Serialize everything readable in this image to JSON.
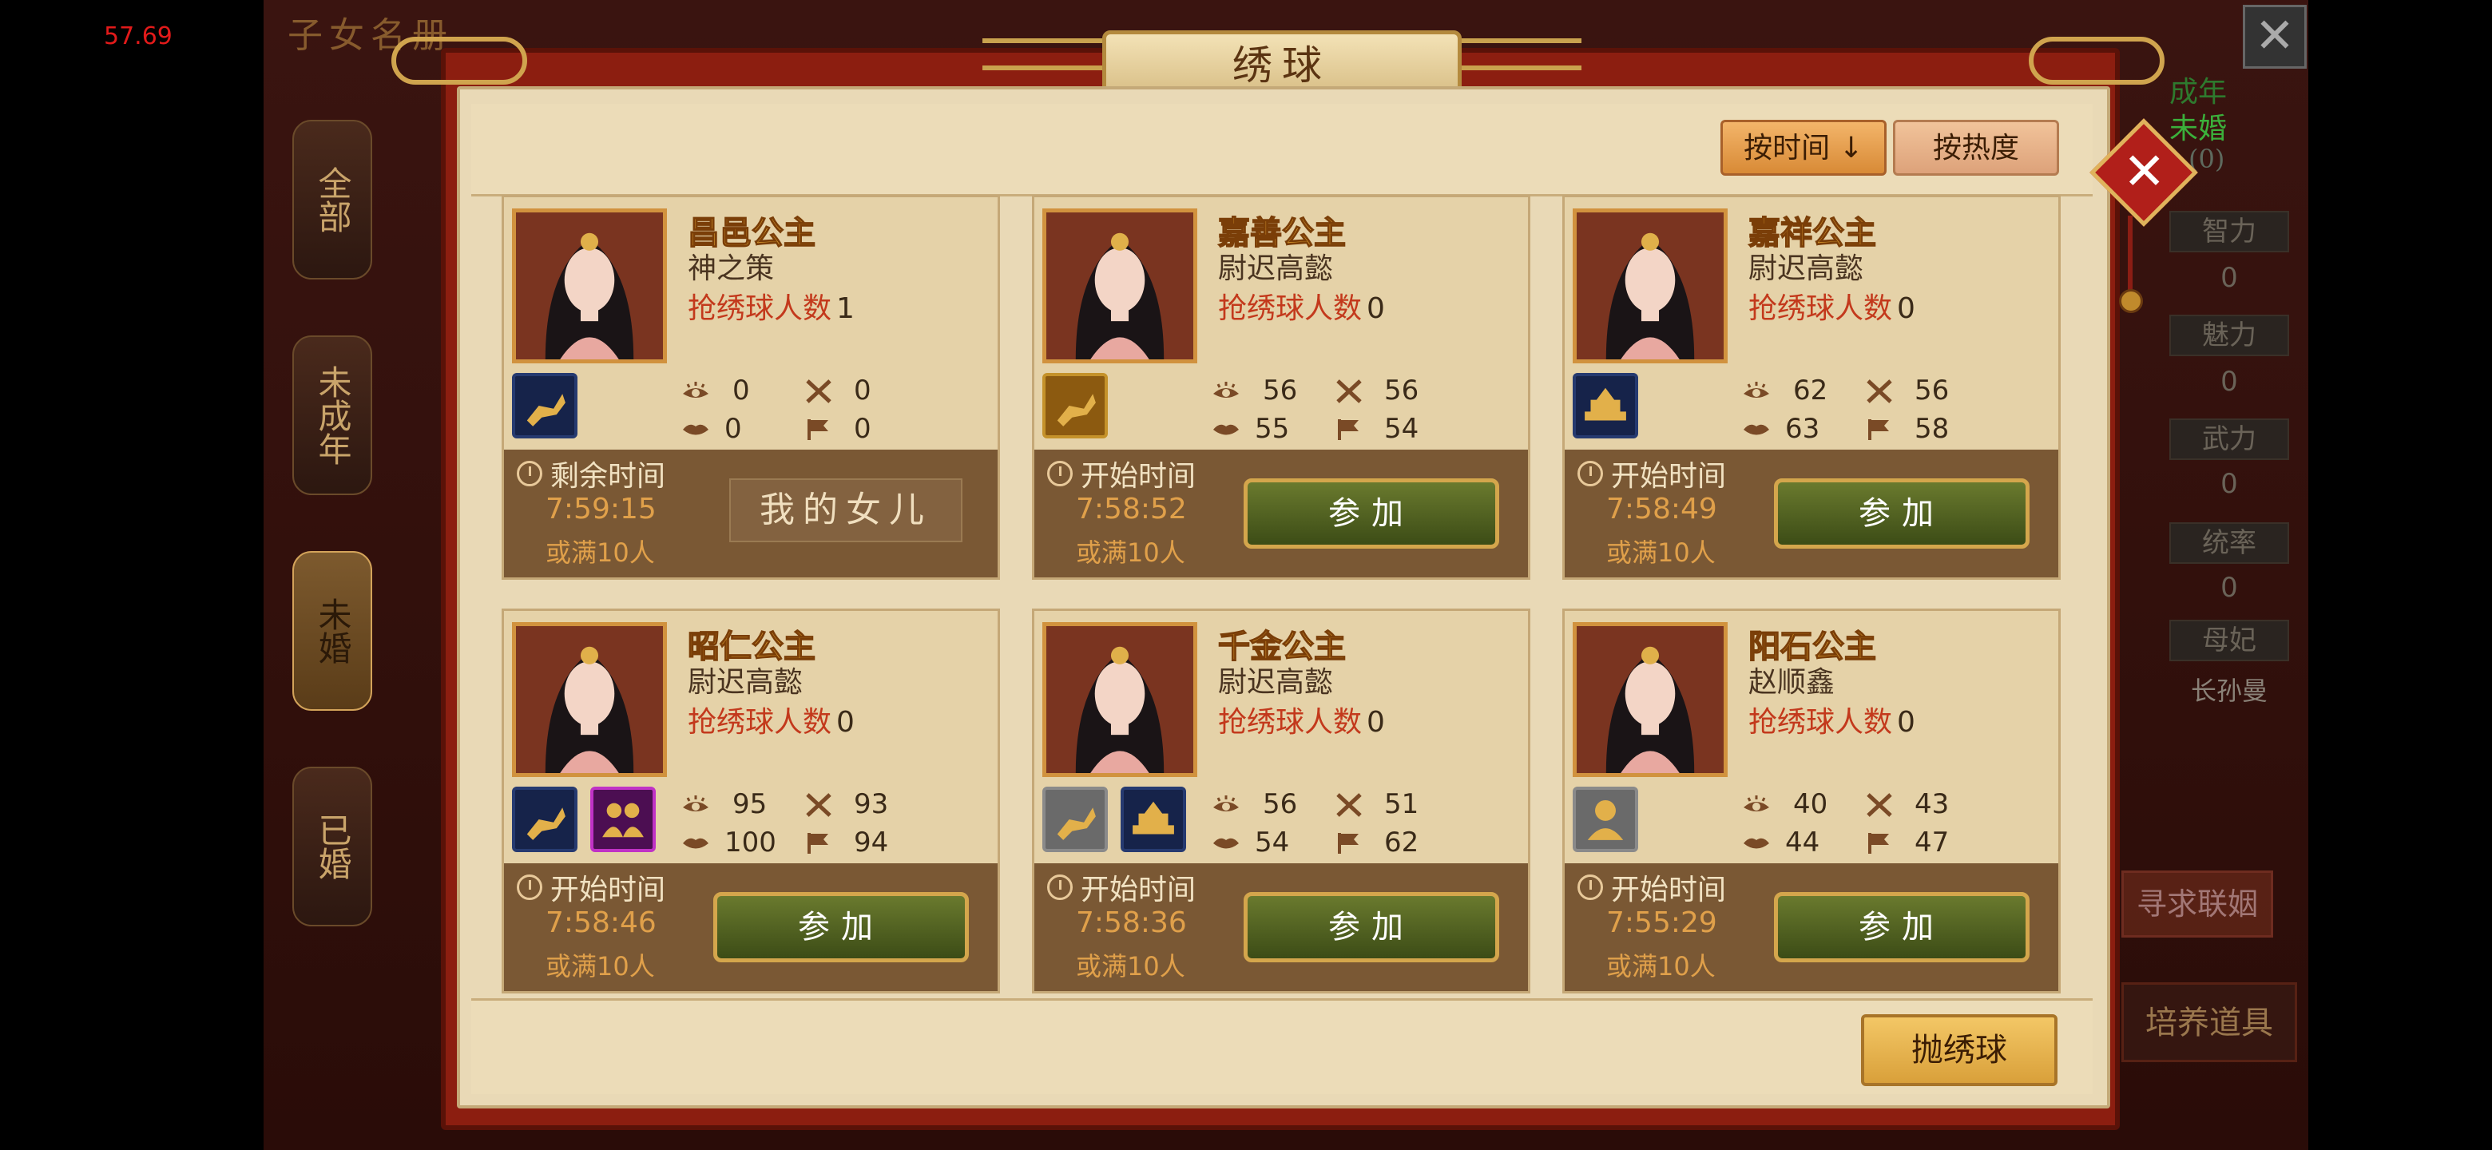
{
  "fps": "57.69",
  "background": {
    "title": "子女名册",
    "side_tabs": [
      {
        "label": "全部",
        "active": false
      },
      {
        "label": "未成年",
        "active": false
      },
      {
        "label": "未婚",
        "active": true
      },
      {
        "label": "已婚",
        "active": false
      }
    ],
    "right_info": {
      "age_status": "成年",
      "marriage_status": "未婚",
      "count": "(0)",
      "stats": [
        {
          "label": "智力",
          "value": "0"
        },
        {
          "label": "魅力",
          "value": "0"
        },
        {
          "label": "武力",
          "value": "0"
        },
        {
          "label": "统率",
          "value": "0"
        },
        {
          "label": "母妃",
          "value": "长孙曼"
        }
      ],
      "seek_marriage_label": "寻求联姻",
      "training_items_label": "培养道具"
    }
  },
  "dialog": {
    "title": "绣球",
    "sort_time_label": "按时间",
    "sort_heat_label": "按热度",
    "throw_label": "抛绣球",
    "count_label": "抢绣球人数",
    "or_full_label": "或满10人",
    "join_label": "参加",
    "mine_label": "我的女儿",
    "cards": [
      {
        "name": "昌邑公主",
        "suitor": "神之策",
        "count": "1",
        "time_label": "剩余时间",
        "time": "7:59:15",
        "traits": [
          "deer-icon"
        ],
        "trait_styles": [
          "blue"
        ],
        "stats": {
          "eye": "0",
          "lips": "0",
          "swords": "0",
          "flag": "0"
        },
        "is_mine": true
      },
      {
        "name": "嘉善公主",
        "suitor": "尉迟高懿",
        "count": "0",
        "time_label": "开始时间",
        "time": "7:58:52",
        "traits": [
          "deer-icon"
        ],
        "trait_styles": [
          "gold"
        ],
        "stats": {
          "eye": "56",
          "lips": "55",
          "swords": "56",
          "flag": "54"
        },
        "is_mine": false
      },
      {
        "name": "嘉祥公主",
        "suitor": "尉迟高懿",
        "count": "0",
        "time_label": "开始时间",
        "time": "7:58:49",
        "traits": [
          "treasure-icon"
        ],
        "trait_styles": [
          "blue"
        ],
        "stats": {
          "eye": "62",
          "lips": "63",
          "swords": "56",
          "flag": "58"
        },
        "is_mine": false
      },
      {
        "name": "昭仁公主",
        "suitor": "尉迟高懿",
        "count": "0",
        "time_label": "开始时间",
        "time": "7:58:46",
        "traits": [
          "deer-icon",
          "couple-icon"
        ],
        "trait_styles": [
          "blue",
          "purple"
        ],
        "stats": {
          "eye": "95",
          "lips": "100",
          "swords": "93",
          "flag": "94"
        },
        "is_mine": false
      },
      {
        "name": "千金公主",
        "suitor": "尉迟高懿",
        "count": "0",
        "time_label": "开始时间",
        "time": "7:58:36",
        "traits": [
          "deer-icon",
          "treasure-icon"
        ],
        "trait_styles": [
          "grey",
          "blue"
        ],
        "stats": {
          "eye": "56",
          "lips": "54",
          "swords": "51",
          "flag": "62"
        },
        "is_mine": false
      },
      {
        "name": "阳石公主",
        "suitor": "赵顺鑫",
        "count": "0",
        "time_label": "开始时间",
        "time": "7:55:29",
        "traits": [
          "person-icon"
        ],
        "trait_styles": [
          "grey"
        ],
        "stats": {
          "eye": "40",
          "lips": "44",
          "swords": "43",
          "flag": "47"
        },
        "is_mine": false
      }
    ]
  }
}
